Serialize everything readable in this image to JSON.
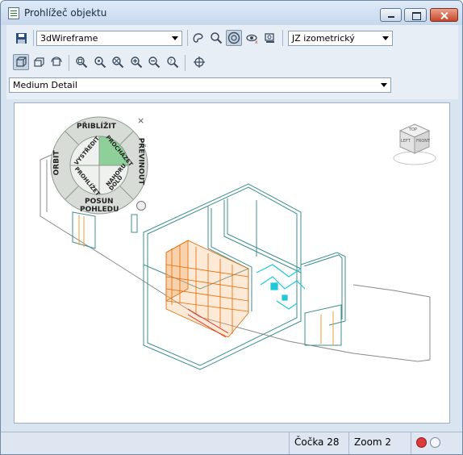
{
  "window": {
    "title": "Prohlížeč objektu"
  },
  "toolbar": {
    "visual_style": "3dWireframe",
    "view_preset": "JZ izometrický",
    "detail_level": "Medium Detail"
  },
  "steering_wheel": {
    "top": "PŘIBLÍŽIT",
    "left": "ORBIT",
    "right": "PŘEVINOUT",
    "bottom_line1": "POSUN",
    "bottom_line2": "POHLEDU",
    "inner_top_left": "VYSTŘEDIT",
    "inner_top_right": "PROCHÁZET",
    "inner_bottom_left": "PROHLÍŽET",
    "inner_bottom_right_line1": "NAHORU",
    "inner_bottom_right_line2": "DOLŮ"
  },
  "viewcube": {
    "faces": [
      "TOP",
      "LEFT",
      "FRONT"
    ]
  },
  "status": {
    "lens": "Čočka 28",
    "zoom": "Zoom 2"
  },
  "colors": {
    "accent_green": "#5aa86a",
    "wall_teal": "#3f8f8f",
    "furniture_orange": "#e86a00",
    "pipes_cyan": "#1ec8d8",
    "status_red": "#e0383a"
  }
}
